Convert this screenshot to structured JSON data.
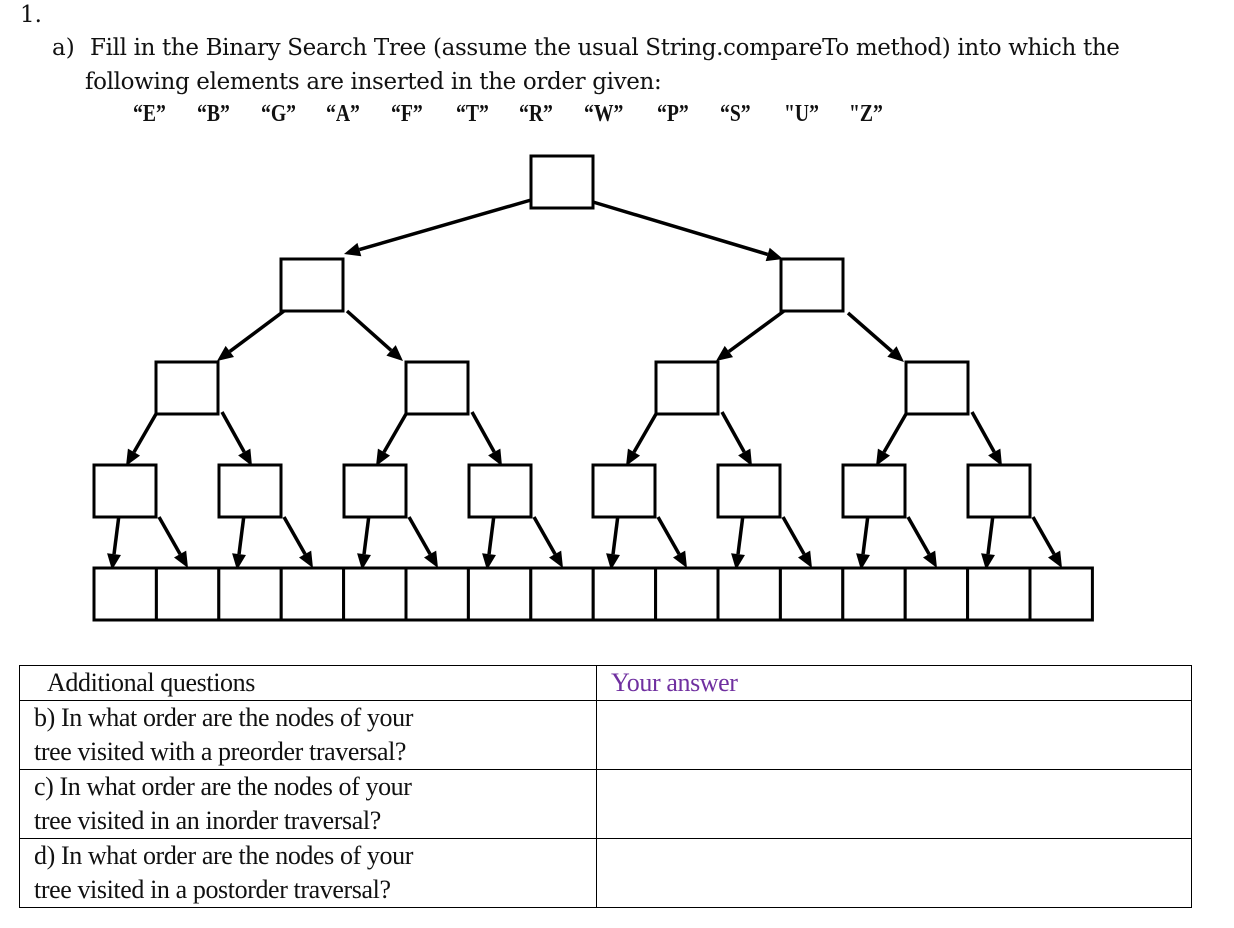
{
  "question": {
    "number": "1.",
    "part_a": {
      "label": "a)",
      "line1": "Fill in the Binary Search Tree (assume the usual String.compareTo method) into  which the",
      "line2": "following elements are inserted in the order given:",
      "elements": [
        "“E”",
        "“B”",
        "“G”",
        "“A”",
        "“F”",
        "“T”",
        "“R”",
        "“W”",
        "“P”",
        "“S”",
        "\"U”",
        "\"Z”"
      ]
    }
  },
  "tree": {
    "levels": 5,
    "node_values": []
  },
  "table": {
    "header": {
      "questions": "Additional questions",
      "answer": "Your answer",
      "answer_color": "#7030a0"
    },
    "rows": [
      {
        "question_line1": "b) In what order are the nodes of your",
        "question_line2": "tree visited with a preorder traversal?",
        "answer": ""
      },
      {
        "question_line1": "c)  In what order are the nodes of your",
        "question_line2": "tree visited in an inorder traversal?",
        "answer": ""
      },
      {
        "question_line1": "d) In what order are the nodes of your",
        "question_line2": "tree visited in a postorder traversal?",
        "answer": ""
      }
    ]
  }
}
